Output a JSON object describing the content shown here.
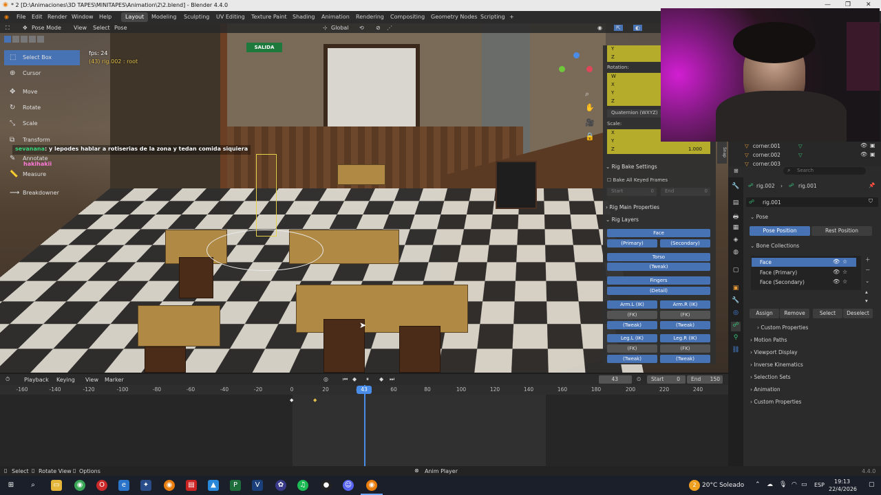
{
  "window": {
    "title": "* 2 [D:\\Animaciones\\3D TAPES\\MINITAPES\\Animation\\2\\2.blend] - Blender 4.4.0",
    "controls": [
      "—",
      "❐",
      "✕"
    ]
  },
  "menu": {
    "items": [
      "File",
      "Edit",
      "Render",
      "Window",
      "Help"
    ],
    "workspaces": [
      "Layout",
      "Modeling",
      "Sculpting",
      "UV Editing",
      "Texture Paint",
      "Shading",
      "Animation",
      "Rendering",
      "Compositing",
      "Geometry Nodes",
      "Scripting"
    ],
    "active_workspace": "Layout",
    "add": "+"
  },
  "viewport": {
    "header": {
      "mode": "Pose Mode",
      "view": "View",
      "select": "Select",
      "pose": "Pose",
      "orientation": "Global"
    },
    "fps": "fps: 24",
    "object_info": "(43) rig.002 : root",
    "tools": [
      "Select Box",
      "Cursor",
      "Move",
      "Rotate",
      "Scale",
      "Transform",
      "Annotate",
      "Measure",
      "Breakdowner"
    ],
    "active_tool": "Select Box",
    "tool_icons": [
      "select-box-icon",
      "cursor-icon",
      "move-icon",
      "rotate-icon",
      "scale-icon",
      "transform-icon",
      "annotate-icon",
      "measure-icon",
      "breakdowner-icon"
    ],
    "chat": [
      {
        "user": "sevanana",
        "message": "y lepodes hablar a rotiserias de la zona y tedan comida siquiera"
      },
      {
        "user": "hakihakii",
        "message": ""
      }
    ],
    "scene_signs": {
      "exit": "SALIDA"
    }
  },
  "npanel": {
    "loc_axes": [
      "Y",
      "Z"
    ],
    "rotation_label": "Rotation:",
    "rotation_axes": [
      "W",
      "X",
      "Y",
      "Z"
    ],
    "rotation_mode": "Quaternion (WXYZ)",
    "scale_label": "Scale:",
    "scale_axes": [
      "X",
      "Y",
      "Z"
    ],
    "scale_z_value": "1.000",
    "rig_bake": {
      "title": "Rig Bake Settings",
      "bake_all": "Bake All Keyed Frames",
      "start_label": "Start",
      "start_value": "0",
      "end_label": "End",
      "end_value": "0"
    },
    "rig_main": "Rig Main Properties",
    "rig_layers": {
      "title": "Rig Layers",
      "face": "Face",
      "face_primary": "(Primary)",
      "face_secondary": "(Secondary)",
      "torso": "Torso",
      "torso_tweak": "(Tweak)",
      "fingers": "Fingers",
      "fingers_detail": "(Detail)",
      "arm_l_ik": "Arm.L (IK)",
      "arm_r_ik": "Arm.R (IK)",
      "fk": "(FK)",
      "tweak": "(Tweak)",
      "leg_l_ik": "Leg.L (IK)",
      "leg_r_ik": "Leg.R (IK)"
    }
  },
  "outliner": {
    "rows": [
      "corner.001",
      "corner.002",
      "corner.003"
    ]
  },
  "properties": {
    "search_placeholder": "Search",
    "breadcrumb": [
      "rig.002",
      "rig.001"
    ],
    "datablock": "rig.001",
    "pose_section": "Pose",
    "pose_position": "Pose Position",
    "rest_position": "Rest Position",
    "bone_collections": "Bone Collections",
    "collections": [
      "Face",
      "Face (Primary)",
      "Face (Secondary)"
    ],
    "active_collection": "Face",
    "assign": "Assign",
    "remove": "Remove",
    "select": "Select",
    "deselect": "Deselect",
    "custom_properties_inner": "Custom Properties",
    "panels": [
      "Motion Paths",
      "Viewport Display",
      "Inverse Kinematics",
      "Selection Sets",
      "Animation",
      "Custom Properties"
    ]
  },
  "timeline": {
    "playback": "Playback",
    "keying": "Keying",
    "view": "View",
    "marker": "Marker",
    "current_frame": "43",
    "start_label": "Start",
    "start_value": "0",
    "end_label": "End",
    "end_value": "150",
    "ticks": [
      "-160",
      "-140",
      "-120",
      "-100",
      "-80",
      "-60",
      "-40",
      "-20",
      "0",
      "20",
      "40",
      "60",
      "80",
      "100",
      "120",
      "140",
      "160",
      "180",
      "200",
      "220",
      "240"
    ],
    "playhead_label": "43"
  },
  "statusbar": {
    "select": "Select",
    "rotate_view": "Rotate View",
    "options": "Options",
    "center": "Anim Player",
    "version": "4.4.0"
  },
  "taskbar": {
    "weather": "20°C Soleado",
    "lang": "ESP",
    "time": "19:13",
    "date": "22/4/2026",
    "weather_badge": "2"
  },
  "colors": {
    "accent_blue": "#4772b3",
    "field_yellow": "#b5ac2c",
    "playhead": "#4a8de8"
  }
}
